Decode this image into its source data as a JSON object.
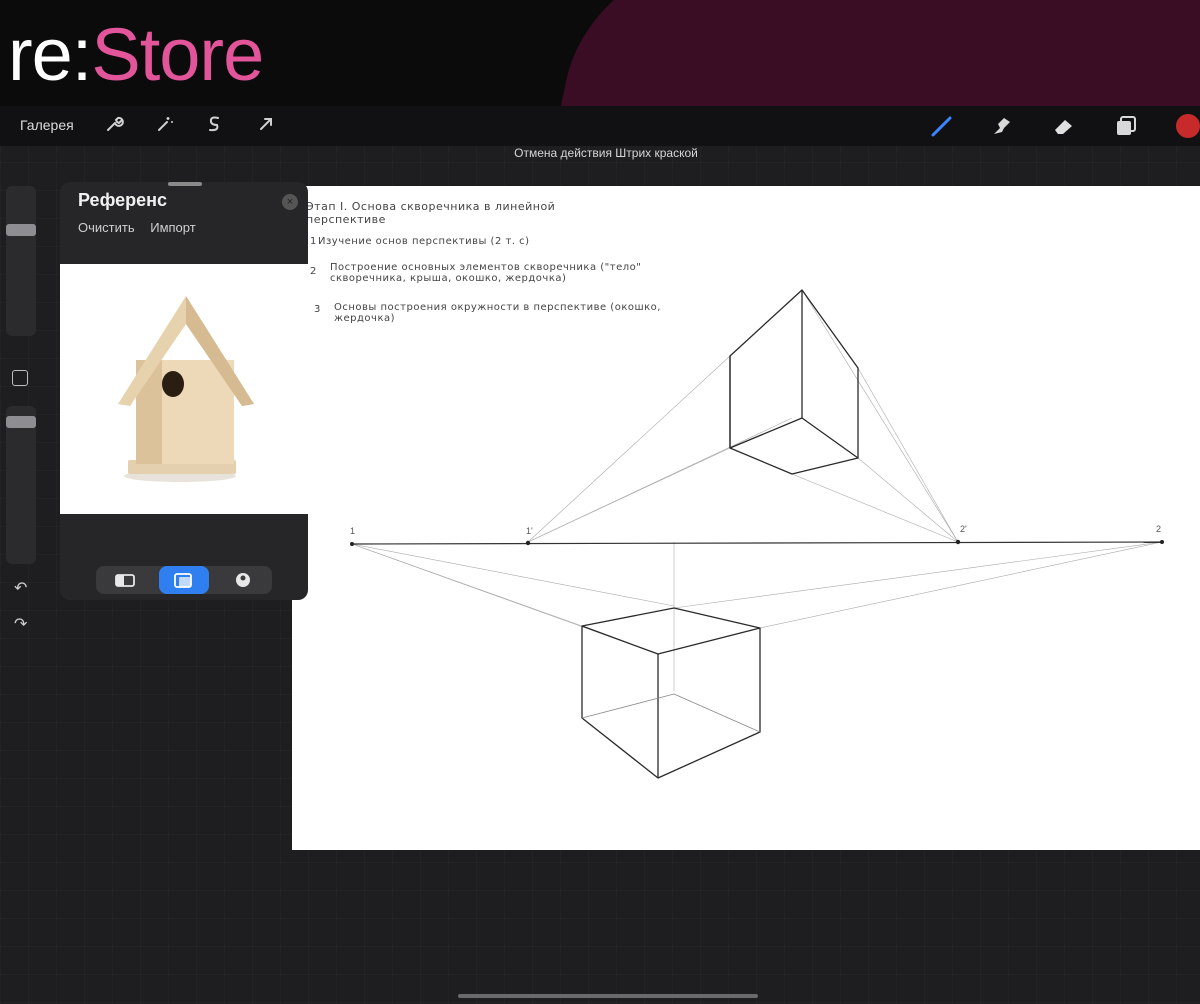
{
  "brand": {
    "re": "re:",
    "store": "Store"
  },
  "toolbar": {
    "gallery_label": "Галерея",
    "undo_caption": "Отмена действия Штрих краской",
    "icons": [
      "wrench-icon",
      "magic-wand-icon",
      "selection-s-icon",
      "transform-arrow-icon"
    ],
    "right_tools": [
      "brush-icon",
      "smudge-icon",
      "eraser-icon",
      "layers-icon"
    ],
    "color": "#c62a2a"
  },
  "reference": {
    "title": "Референс",
    "clear_label": "Очистить",
    "import_label": "Импорт",
    "tabs": [
      "canvas-tab-icon",
      "image-tab-icon",
      "face-tab-icon"
    ],
    "active_tab": 1
  },
  "canvas_notes": {
    "title": "Этап I. Основа скворечника в линейной перспективе",
    "step1": "Изучение основ перспективы (2 т. с)",
    "step2": "Построение основных элементов скворечника (\"тело\" скворечника, крыша, окошко, жердочка)",
    "step3": "Основы построения окружности в перспективе (окошко, жердочка)",
    "num1": "1",
    "num2": "2",
    "num3": "3",
    "point1": "1",
    "point1p": "1'",
    "point2p": "2'",
    "point2": "2"
  }
}
